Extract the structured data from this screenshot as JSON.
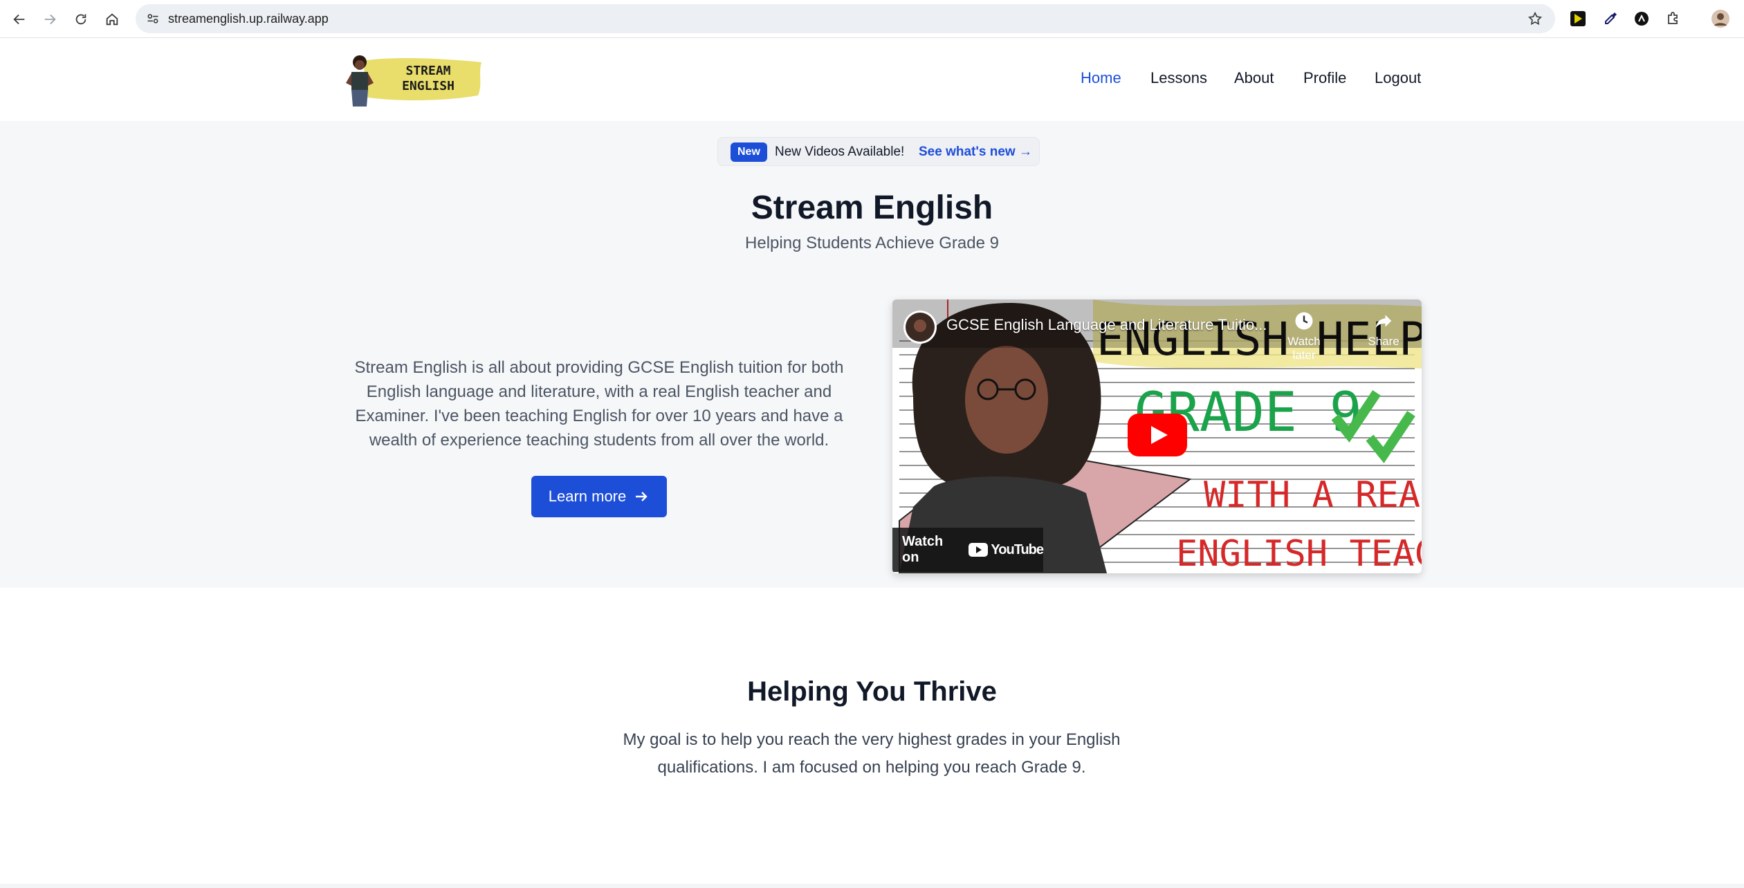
{
  "browser": {
    "url": "streamenglish.up.railway.app"
  },
  "header": {
    "logo_text_line1": "STREAM",
    "logo_text_line2": "ENGLISH",
    "nav": [
      "Home",
      "Lessons",
      "About",
      "Profile",
      "Logout"
    ]
  },
  "announcement": {
    "badge": "New",
    "text": "New Videos Available!",
    "link": "See what's new →"
  },
  "hero": {
    "title": "Stream English",
    "subtitle": "Helping Students Achieve Grade 9",
    "body": "Stream English is all about providing GCSE English tuition for both English language and literature, with a real English teacher and Examiner. I've been teaching English for over 10 years and have a wealth of experience teaching students from all over the world.",
    "cta": "Learn more"
  },
  "video": {
    "title": "GCSE English Language and Literature Tuitio...",
    "watch_later": "Watch later",
    "share": "Share",
    "watch_on": "Watch on",
    "youtube": "YouTube",
    "thumb_line1": "ENGLISH HELP",
    "thumb_line2": "GRADE 9",
    "thumb_line3": "WITH A REAL",
    "thumb_line4": "ENGLISH TEACHER"
  },
  "thrive": {
    "title": "Helping You Thrive",
    "text": "My goal is to help you reach the very highest grades in your English qualifications. I am focused on helping you reach Grade 9."
  },
  "colors": {
    "accent": "#1d4ed8",
    "hero_bg": "#f6f7f9"
  }
}
